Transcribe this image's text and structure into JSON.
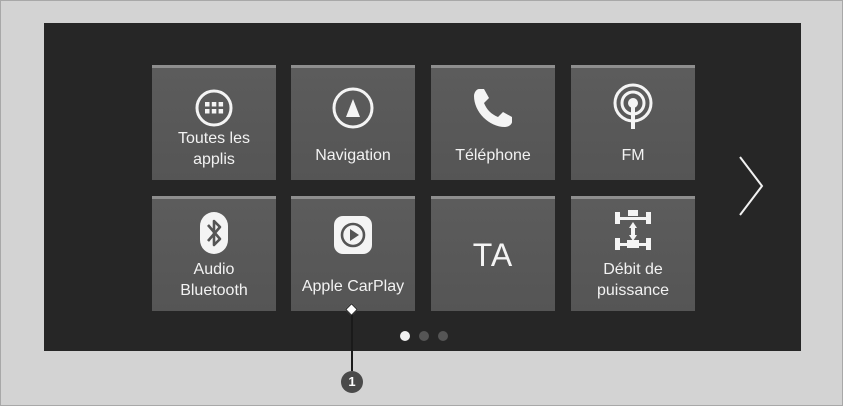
{
  "tiles": [
    {
      "label_lines": [
        "Toutes les",
        "applis"
      ],
      "icon": "grid-apps-icon"
    },
    {
      "label_lines": [
        "Navigation"
      ],
      "icon": "navigation-compass-icon"
    },
    {
      "label_lines": [
        "Téléphone"
      ],
      "icon": "phone-handset-icon"
    },
    {
      "label_lines": [
        "FM"
      ],
      "icon": "radio-broadcast-icon"
    },
    {
      "label_lines": [
        "Audio",
        "Bluetooth"
      ],
      "icon": "bluetooth-icon"
    },
    {
      "label_lines": [
        "Apple CarPlay"
      ],
      "icon": "carplay-icon"
    },
    {
      "label_lines": [
        "TA"
      ],
      "icon": null
    },
    {
      "label_lines": [
        "Débit de",
        "puissance"
      ],
      "icon": "power-flow-icon"
    }
  ],
  "pager": {
    "pages": 3,
    "current": 1
  },
  "next_page_icon": "chevron-right-icon",
  "callout": {
    "number": "1",
    "target": "Apple CarPlay"
  },
  "colors": {
    "screen_bg": "#262626",
    "tile_bg": "#595959",
    "tile_top_border": "#8e8e8e",
    "frame_bg": "#d3d3d3",
    "text": "#f2f2f2"
  }
}
